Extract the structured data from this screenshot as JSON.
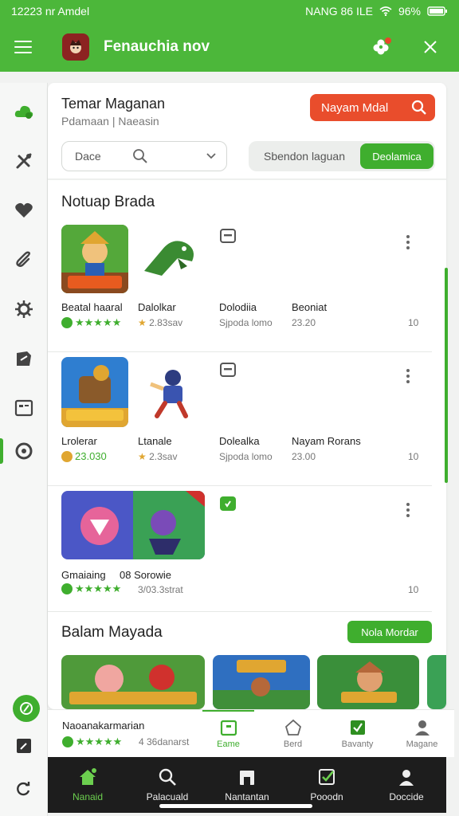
{
  "status": {
    "time": "12223 nr Amdel",
    "right": "NANG 86 ILE",
    "battery": "96%"
  },
  "appbar": {
    "title": "Fenauchia nov"
  },
  "header": {
    "title": "Temar Maganan",
    "subtitle": "Pdamaan | Naeasin",
    "primary_button": "Nayam Mdal",
    "select_value": "Dace",
    "seg_left": "Sbendon laguan",
    "seg_right": "Deolamica"
  },
  "list": {
    "title": "Notuap Brada",
    "rows": [
      {
        "col1_title": "Beatal haaral",
        "col1_rating": "★★★★★",
        "col2_title": "Dalolkar",
        "col2_meta": "2.83sav",
        "col3_title": "Dolodiia",
        "col3_meta": "Sjpoda lomo",
        "col4_title": "Beoniat",
        "col4_meta": "23.20",
        "count": "10"
      },
      {
        "col1_title": "Lrolerar",
        "col1_rating": "23.030",
        "col2_title": "Ltanale",
        "col2_meta": "2.3sav",
        "col3_title": "Dolealka",
        "col3_meta": "Sjpoda lomo",
        "col4_title": "Nayam Rorans",
        "col4_meta": "23.00",
        "count": "10"
      },
      {
        "col1_title": "Gmaiaing",
        "col1_rating": "★★★★★",
        "col2_title": "08 Sorowie",
        "col2_meta": "3/03.3strat",
        "count": "10"
      }
    ]
  },
  "featured": {
    "title": "Balam Mayada",
    "button": "Nola Mordar"
  },
  "bottom_info": {
    "title": "Naoanakarmarian",
    "rating": "★★★★★",
    "meta": "4 36danarst"
  },
  "tabs2": [
    "Eame",
    "Berd",
    "Bavanty",
    "Magane"
  ],
  "nav": [
    "Nanaid",
    "Palacuald",
    "Nantantan",
    "Pooodn",
    "Doccide"
  ],
  "colors": {
    "accent": "#3fae2e",
    "appbar": "#4cb73a",
    "primary": "#e94d2c"
  }
}
